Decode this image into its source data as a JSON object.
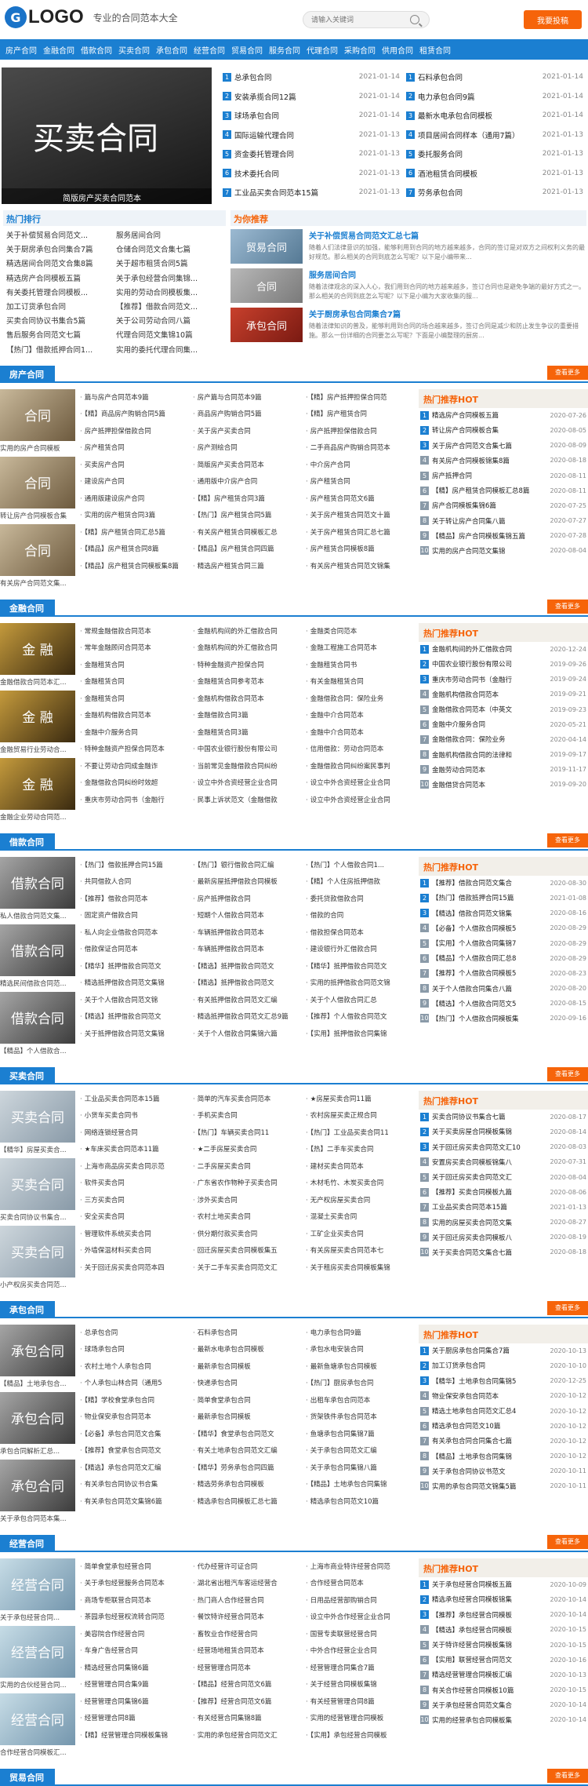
{
  "header": {
    "logo_mark": "G",
    "logo_text": "LOGO",
    "slogan": "专业的合同范本大全",
    "search_placeholder": "请输入关键词",
    "submit": "我要投稿",
    "brand_color": "#1b7fd1",
    "accent_color": "#f6640a"
  },
  "nav": [
    "房产合同",
    "金融合同",
    "借款合同",
    "买卖合同",
    "承包合同",
    "经营合同",
    "贸易合同",
    "服务合同",
    "代理合同",
    "采购合同",
    "供用合同",
    "租赁合同"
  ],
  "banner": {
    "title": "买卖合同",
    "subtitle": "简版房产买卖合同范本"
  },
  "top_left": [
    {
      "t": "总承包合同",
      "d": "2021-01-14"
    },
    {
      "t": "安装承揽合同12篇",
      "d": "2021-01-14"
    },
    {
      "t": "球场承包合同",
      "d": "2021-01-14"
    },
    {
      "t": "国际运输代理合同",
      "d": "2021-01-13"
    },
    {
      "t": "资金委托管理合同",
      "d": "2021-01-13"
    },
    {
      "t": "技术委托合同",
      "d": "2021-01-13"
    },
    {
      "t": "工业品买卖合同范本15篇",
      "d": "2021-01-13"
    }
  ],
  "top_right": [
    {
      "t": "石料承包合同",
      "d": "2021-01-14"
    },
    {
      "t": "电力承包合同9篇",
      "d": "2021-01-14"
    },
    {
      "t": "最新水电承包合同模板",
      "d": "2021-01-14"
    },
    {
      "t": "项目居间合同样本（通用7篇）",
      "d": "2021-01-13"
    },
    {
      "t": "委托服务合同",
      "d": "2021-01-13"
    },
    {
      "t": "酒池租赁合同模板",
      "d": "2021-01-13"
    },
    {
      "t": "劳务承包合同",
      "d": "2021-01-13"
    }
  ],
  "hot_rank": {
    "title": "热门排行",
    "items": [
      "关于补偿贸易合同范文...",
      "服务居间合同",
      "关于厨房承包合同集合7篇",
      "仓储合同范文合集七篇",
      "精选居间合同范文合集8篇",
      "关于超市租赁合同5篇",
      "精选房产合同模板五篇",
      "关于承包经营合同集锦...",
      "有关委托管理合同模板...",
      "实用的劳动合同模板集...",
      "加工订货承包合同",
      "【推荐】借款合同范文...",
      "买卖合同协议书集合5篇",
      "关于公司劳动合同八篇",
      "售后服务合同范文七篇",
      "代理合同范文集锦10篇",
      "【热门】借款抵押合同1...",
      "实用的委托代理合同集..."
    ]
  },
  "recommend": {
    "title": "为你推荐",
    "items": [
      {
        "thumb": "贸易合同",
        "t": "关于补偿贸易合同范文汇总七篇",
        "desc": "随着人们法律意识的加强，能够利用到合同的地方越来越多，合同的签订是对双方之间权利义务的最好规范。那么相关的合同到底怎么写呢？以下是小编带来..."
      },
      {
        "thumb": "合同",
        "t": "服务居间合同",
        "desc": "随着法律观念的深入人心，我们用到合同的地方越来越多，签订合同也是避免争端的最好方式之一。那么相关的合同到底怎么写呢？以下是小编为大家收集的服..."
      },
      {
        "thumb": "承包合同",
        "t": "关于厨房承包合同集合7篇",
        "desc": "随着法律知识的普及，能够利用到合同的场合越来越多，签订合同是减少和防止发生争议的重要措施。那么一份详细的合同要怎么写呢？下面是小编整理的厨房..."
      }
    ]
  },
  "sections": [
    {
      "name": "房产合同",
      "more": "查看更多",
      "thumb_style": "im",
      "thumbs": [
        {
          "l": "合同",
          "c": "实用的房产合同模板"
        },
        {
          "l": "合同",
          "c": "转让房产合同模板合集"
        },
        {
          "l": "合同",
          "c": "有关房产合同范文集..."
        }
      ],
      "items": [
        "篇与房产合同范本9篇",
        "房产篇与合同范本9篇",
        "【精】房产抵押担保合同范",
        "【精】商品房产购销合同5篇",
        "商品房产购销合同5篇",
        "【精】房产租赁合同",
        "房产抵押担保借款合同",
        "关于房产买卖合同",
        "房产抵押担保借款合同",
        "房产租赁合同",
        "房产测绘合同",
        "二手商品房产购销合同范本",
        "买卖房产合同",
        "简版房产买卖合同范本",
        "中介房产合同",
        "建设房产合同",
        "通用版中介房产合同",
        "房产租赁合同",
        "通用版建设房产合同",
        "【精】房产租赁合同3篇",
        "房产租赁合同范文6篇",
        "实用的房产租赁合同3篇",
        "【热门】房产租赁合同5篇",
        "关于房产租赁合同范文十篇",
        "【精】房产租赁合同汇总5篇",
        "有关房产租赁合同模板汇总",
        "关于房产租赁合同汇总七篇",
        "【精品】房产租赁合同8篇",
        "【精品】房产租赁合同四篇",
        "房产租赁合同模板8篇",
        "【精品】房产租赁合同模板集8篇",
        "精选房产租赁合同三篇",
        "有关房产租赁合同范文锦集"
      ],
      "side_title": "热门推荐HOT",
      "side": [
        {
          "t": "精选房产合同模板五篇",
          "d": "2020-07-26"
        },
        {
          "t": "转让房产合同模板合集",
          "d": "2020-08-05"
        },
        {
          "t": "关于房产合同范文合集七篇",
          "d": "2020-08-09"
        },
        {
          "t": "有关房产合同模板锦集8篇",
          "d": "2020-08-18"
        },
        {
          "t": "房产抵押合同",
          "d": "2020-08-11"
        },
        {
          "t": "【精】房产租赁合同模板汇总8篇",
          "d": "2020-08-11"
        },
        {
          "t": "房产合同模板集锦6篇",
          "d": "2020-07-25"
        },
        {
          "t": "关于转让房产合同集八篇",
          "d": "2020-07-27"
        },
        {
          "t": "【精品】房产合同模板集锦五篇",
          "d": "2020-07-28"
        },
        {
          "t": "实用的房产合同范文集锦",
          "d": "2020-08-04"
        }
      ]
    },
    {
      "name": "金融合同",
      "more": "查看更多",
      "thumb_style": "im gold",
      "thumbs": [
        {
          "l": "金 融",
          "c": "金融借款合同范本汇..."
        },
        {
          "l": "金 融",
          "c": "金融贸易行业劳动合..."
        },
        {
          "l": "金 融",
          "c": "金融企业劳动合同范..."
        }
      ],
      "items": [
        "常规金融借款合同范本",
        "金融机构间的外汇借款合同",
        "金融类合同范本",
        "常年金融顾问合同范本",
        "金融机构间的外汇借款合同",
        "金融工程施工合同范本",
        "金融租赁合同",
        "特种金融资产担保合同",
        "金融租赁合同书",
        "金融租赁合同",
        "金融租赁合同参考范本",
        "有关金融租赁合同",
        "金融租赁合同",
        "金融机构借款合同范本",
        "金融借款合同：保险业务",
        "金融机构借款合同范本",
        "金融借款合同3篇",
        "金融中介合同范本",
        "金融中介服务合同",
        "金融租赁合同3篇",
        "金融中介合同范本",
        "特种金融资产担保合同范本",
        "中国农业银行股份有限公司",
        "信用借款：劳动合同范本",
        "不要让劳动合同成金融诈",
        "当前常见金融借款合同纠纷",
        "金融借款合同纠纷案民事判",
        "金融借款合同纠纷时效超",
        "设立中外合资经营企业合同",
        "设立中外合资经营企业合同",
        "重庆市劳动合同书（金融行",
        "民事上诉状范文（金融借款",
        "设立中外合资经营企业合同"
      ],
      "side_title": "热门推荐HOT",
      "side": [
        {
          "t": "金融机构间的外汇借款合同",
          "d": "2020-12-24"
        },
        {
          "t": "中国农业银行股份有限公司",
          "d": "2019-09-26"
        },
        {
          "t": "重庆市劳动合同书（金融行",
          "d": "2019-09-24"
        },
        {
          "t": "金融机构借款合同范本",
          "d": "2019-09-21"
        },
        {
          "t": "金融借款合同范本（中英文",
          "d": "2019-09-23"
        },
        {
          "t": "金融中介服务合同",
          "d": "2020-05-21"
        },
        {
          "t": "金融借款合同：保险业务",
          "d": "2020-04-14"
        },
        {
          "t": "金融机构借款合同的法律和",
          "d": "2019-09-17"
        },
        {
          "t": "金融劳动合同范本",
          "d": "2019-11-17"
        },
        {
          "t": "金融借贷合同范本",
          "d": "2019-09-20"
        }
      ]
    },
    {
      "name": "借款合同",
      "more": "查看更多",
      "thumb_style": "im gray",
      "thumbs": [
        {
          "l": "借款合同",
          "c": "私人借款合同范文集..."
        },
        {
          "l": "借款合同",
          "c": "精选民间借款合同范..."
        },
        {
          "l": "借款合同",
          "c": "【精品】个人借款合..."
        }
      ],
      "items": [
        "【热门】借款抵押合同15篇",
        "【热门】银行借款合同汇编",
        "【热门】个人借款合同1...",
        "共同借款人合同",
        "最新房屋抵押借款合同模板",
        "【精】个人住房抵押借款",
        "【推荐】借款合同范本",
        "房产抵押借款合同",
        "委托贷款借款合同",
        "固定资产借款合同",
        "短期个人借款合同范本",
        "借款的合同",
        "私人向企业借款合同范本",
        "车辆抵押借款合同范本",
        "借款担保合同范本",
        "借款保证合同范本",
        "车辆抵押借款合同范本",
        "建设银行外汇借款合同",
        "【精华】抵押借款合同范文",
        "【精选】抵押借款合同范文",
        "【精华】抵押借款合同范文",
        "精选抵押借款合同范文集锦",
        "【精选】抵押借款合同范文",
        "实用的抵押借款合同范文锦",
        "关于个人借款合同范文锦",
        "有关抵押借款合同范文汇编",
        "关于个人借款合同汇总",
        "【精选】抵押借款合同范文",
        "精选抵押借款合同范文汇总9篇",
        "【推荐】个人借款合同范文",
        "关于抵押借款合同范文集锦",
        "关于个人借款合同集锦六篇",
        "【实用】抵押借款合同集锦"
      ],
      "side_title": "热门推荐HOT",
      "side": [
        {
          "t": "【推荐】借款合同范文集合",
          "d": "2020-08-30"
        },
        {
          "t": "【热门】借款抵押合同15篇",
          "d": "2021-01-08"
        },
        {
          "t": "【精选】借款合同范文锦集",
          "d": "2020-08-16"
        },
        {
          "t": "【必备】个人借款合同模板5",
          "d": "2020-08-29"
        },
        {
          "t": "【实用】个人借款合同集锦7",
          "d": "2020-08-29"
        },
        {
          "t": "【精品】个人借款合同汇总8",
          "d": "2020-08-29"
        },
        {
          "t": "【推荐】个人借款合同模板5",
          "d": "2020-08-23"
        },
        {
          "t": "关于个人借款合同集合八篇",
          "d": "2020-08-20"
        },
        {
          "t": "【精选】个人借款合同范文5",
          "d": "2020-08-15"
        },
        {
          "t": "【热门】个人借款合同模板集",
          "d": "2020-09-16"
        }
      ]
    },
    {
      "name": "买卖合同",
      "more": "查看更多",
      "thumb_style": "im sky",
      "thumbs": [
        {
          "l": "买卖合同",
          "c": "【精华】房屋买卖合..."
        },
        {
          "l": "买卖合同",
          "c": "买卖合同协议书集合..."
        },
        {
          "l": "买卖合同",
          "c": "小产权房买卖合同范..."
        }
      ],
      "items": [
        "工业品买卖合同范本15篇",
        "简单的汽车买卖合同范本",
        "★房屋买卖合同11篇",
        "小货车买卖合同书",
        "手机买卖合同",
        "农村房屋买卖正规合同",
        "网络连锁经营合同",
        "【热门】车辆买卖合同11",
        "【热门】工业品买卖合同11",
        "★车床买卖合同范本11篇",
        "★二手房屋买卖合同",
        "【热】二手车买卖合同",
        "上海市商品房买卖合同示范",
        "二手房屋买卖合同",
        "建材买卖合同范本",
        "软件买卖合同",
        "广东省农作物种子买卖合同",
        "木材毛竹、木炭买卖合同",
        "三方买卖合同",
        "涉外买卖合同",
        "无产权房屋买卖合同",
        "安全买卖合同",
        "农村土地买卖合同",
        "混凝土买卖合同",
        "管理软件系统买卖合同",
        "供分期付款买卖合同",
        "工矿企业买卖合同",
        "外墙保温材料买卖合同",
        "回迁房屋买卖合同模板集五",
        "有关房屋买卖合同范本七",
        "关于回迁房买卖合同范本四",
        "关于二手车买卖合同范文汇",
        "关于租房买卖合同模板集锦"
      ],
      "side_title": "热门推荐HOT",
      "side": [
        {
          "t": "买卖合同协议书集合七篇",
          "d": "2020-08-17"
        },
        {
          "t": "关于买卖房屋合同模板集锦",
          "d": "2020-08-14"
        },
        {
          "t": "关于回迁房买卖合同范文汇10",
          "d": "2020-08-03"
        },
        {
          "t": "安置房买卖合同模板锦集八",
          "d": "2020-07-31"
        },
        {
          "t": "关于回迁房买卖合同范文汇",
          "d": "2020-08-04"
        },
        {
          "t": "【推荐】买卖合同模板九篇",
          "d": "2020-08-06"
        },
        {
          "t": "工业品买卖合同范本15篇",
          "d": "2021-01-13"
        },
        {
          "t": "实用的房屋买卖合同范文集",
          "d": "2020-08-27"
        },
        {
          "t": "关于回迁房买卖合同模板八",
          "d": "2020-08-19"
        },
        {
          "t": "关于买卖合同范文集合七篇",
          "d": "2020-08-18"
        }
      ]
    },
    {
      "name": "承包合同",
      "more": "查看更多",
      "thumb_style": "im gray",
      "thumbs": [
        {
          "l": "承包合同",
          "c": "【精品】土地承包合..."
        },
        {
          "l": "承包合同",
          "c": "承包合同解析汇总..."
        },
        {
          "l": "承包合同",
          "c": "关于承包合同范本集..."
        }
      ],
      "items": [
        "总承包合同",
        "石料承包合同",
        "电力承包合同9篇",
        "球场承包合同",
        "最新水电承包合同模板",
        "承包水电安装合同",
        "农村土地个人承包合同",
        "最新承包合同模板",
        "最新鱼塘承包合同模板",
        "个人承包山林合同（通用5",
        "快递承包合同",
        "【热门】厨房承包合同",
        "【精】学校食堂承包合同",
        "简单食堂承包合同",
        "出租车承包合同范本",
        "物业保安承包合同范本",
        "最新承包合同模板",
        "货架铁件承包合同范本",
        "【必备】承包合同范文合集",
        "【精华】食堂承包合同范文",
        "鱼塘承包合同集锦7篇",
        "【推荐】食堂承包合同范文",
        "有关土地承包合同范文汇编",
        "关于承包合同范文汇编",
        "【精选】承包合同范文汇编",
        "【精华】劳务承包合同四篇",
        "关于承包合同集锦八篇",
        "有关承包合同协议书合集",
        "精选劳务承包合同模板",
        "【精品】土地承包合同集锦",
        "有关承包合同范文集锦6篇",
        "精选承包合同模板汇总七篇",
        "精选承包合同范文10篇"
      ],
      "side_title": "热门推荐HOT",
      "side": [
        {
          "t": "关于厨房承包合同集合7篇",
          "d": "2020-10-13"
        },
        {
          "t": "加工订货承包合同",
          "d": "2020-10-10"
        },
        {
          "t": "【精华】土地承包合同集锦5",
          "d": "2020-12-25"
        },
        {
          "t": "物业保安承包合同范本",
          "d": "2020-10-12"
        },
        {
          "t": "精选土地承包合同范文汇总4",
          "d": "2020-10-12"
        },
        {
          "t": "精选承包合同范文10篇",
          "d": "2020-10-12"
        },
        {
          "t": "有关承包合同合同集合七篇",
          "d": "2020-10-12"
        },
        {
          "t": "【精品】土地承包合同集锦",
          "d": "2020-10-12"
        },
        {
          "t": "关于承包合同协议书范文",
          "d": "2020-10-11"
        },
        {
          "t": "实用的承包合同范文锦集5篇",
          "d": "2020-10-11"
        }
      ]
    },
    {
      "name": "经营合同",
      "more": "查看更多",
      "thumb_style": "im cyan",
      "thumbs": [
        {
          "l": "经营合同",
          "c": "关于承包经营合同..."
        },
        {
          "l": "经营合同",
          "c": "实用的合伙经营合同..."
        },
        {
          "l": "经营合同",
          "c": "合作经营合同模板汇..."
        }
      ],
      "items": [
        "简单食堂承包经营合同",
        "代办经营许可证合同",
        "上海市商业特许经营合同范",
        "关于承包经营服务合同范本",
        "湖北省出租汽车客运经营合",
        "合作经营合同范本",
        "商场专柜联营合同范本",
        "热门商人合作经营合同",
        "日用品经营部购销合同",
        "茶园承包经营权流转合同范",
        "餐饮特许经营合同范本",
        "设立中外合作经营企业合同",
        "美容院合作经营合同",
        "畜牧业合作经营合同",
        "国营专卖联营经营合同",
        "车身广告经营合同",
        "经营场地租赁合同范本",
        "中外合作经营企业合同",
        "精选经营合同集锦6篇",
        "经营管理合同范本",
        "经营管理合同集合7篇",
        "经营管理合同合集9篇",
        "【精品】经营合同范文6篇",
        "关于经营合同模板集锦",
        "经营管理合同集锦6篇",
        "【推荐】经营合同范文6篇",
        "有关经营管理合同8篇",
        "经营管理合同8篇",
        "有关经营合同集锦8篇",
        "实用的经营管理合同模板",
        "【精】经营管理合同模板集锦",
        "实用的承包经营合同范文汇",
        "【实用】承包经营合同模板"
      ],
      "side_title": "热门推荐HOT",
      "side": [
        {
          "t": "关于承包经营合同模板五篇",
          "d": "2020-10-09"
        },
        {
          "t": "精选承包经营合同模板锦集",
          "d": "2020-10-14"
        },
        {
          "t": "【推荐】承包经营合同模板",
          "d": "2020-10-14"
        },
        {
          "t": "【精选】承包经营合同模板",
          "d": "2020-10-15"
        },
        {
          "t": "关于特许经营合同模板集锦",
          "d": "2020-10-15"
        },
        {
          "t": "【实用】联营经营合同范文",
          "d": "2020-10-16"
        },
        {
          "t": "精选经营管理合同模板汇编",
          "d": "2020-10-13"
        },
        {
          "t": "有关合作经营合同模板10篇",
          "d": "2020-10-15"
        },
        {
          "t": "关于承包经营合同范文集合",
          "d": "2020-10-14"
        },
        {
          "t": "实用的经营承包合同模板集",
          "d": "2020-10-14"
        }
      ]
    }
  ],
  "last_section": {
    "name": "贸易合同",
    "more": "查看更多"
  }
}
